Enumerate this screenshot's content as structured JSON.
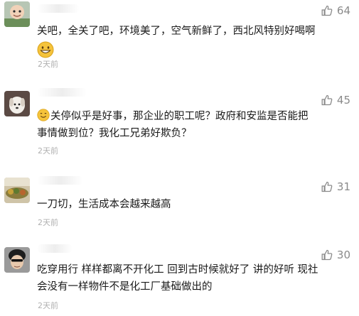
{
  "comments": [
    {
      "likes": "64",
      "text_line1": "关吧，全关了吧，环境美了，空气新鲜了，西北风特别好喝啊",
      "emoji": "grinning-emoji",
      "time": "2天前"
    },
    {
      "likes": "45",
      "emoji": "smiling-emoji",
      "text_line1": "关停似乎是好事，那企业的职工呢？政府和安监是否能把",
      "text_line2": "事情做到位？我化工兄弟好欺负？",
      "time": "2天前"
    },
    {
      "likes": "31",
      "text_line1": "一刀切，生活成本会越来越高",
      "time": "2天前"
    },
    {
      "likes": "30",
      "text_line1": "吃穿用行 样样都离不开化工 回到古时候就好了 讲的好听 现社",
      "text_line2": "会没有一样物件不是化工厂基础做出的",
      "time": "2天前"
    }
  ],
  "colors": {
    "text": "#1a1a1a",
    "muted": "#8a8a8a",
    "time": "#b0b0b0",
    "emoji": "#f5c33b"
  },
  "icons": {
    "like": "thumbs-up-icon"
  }
}
